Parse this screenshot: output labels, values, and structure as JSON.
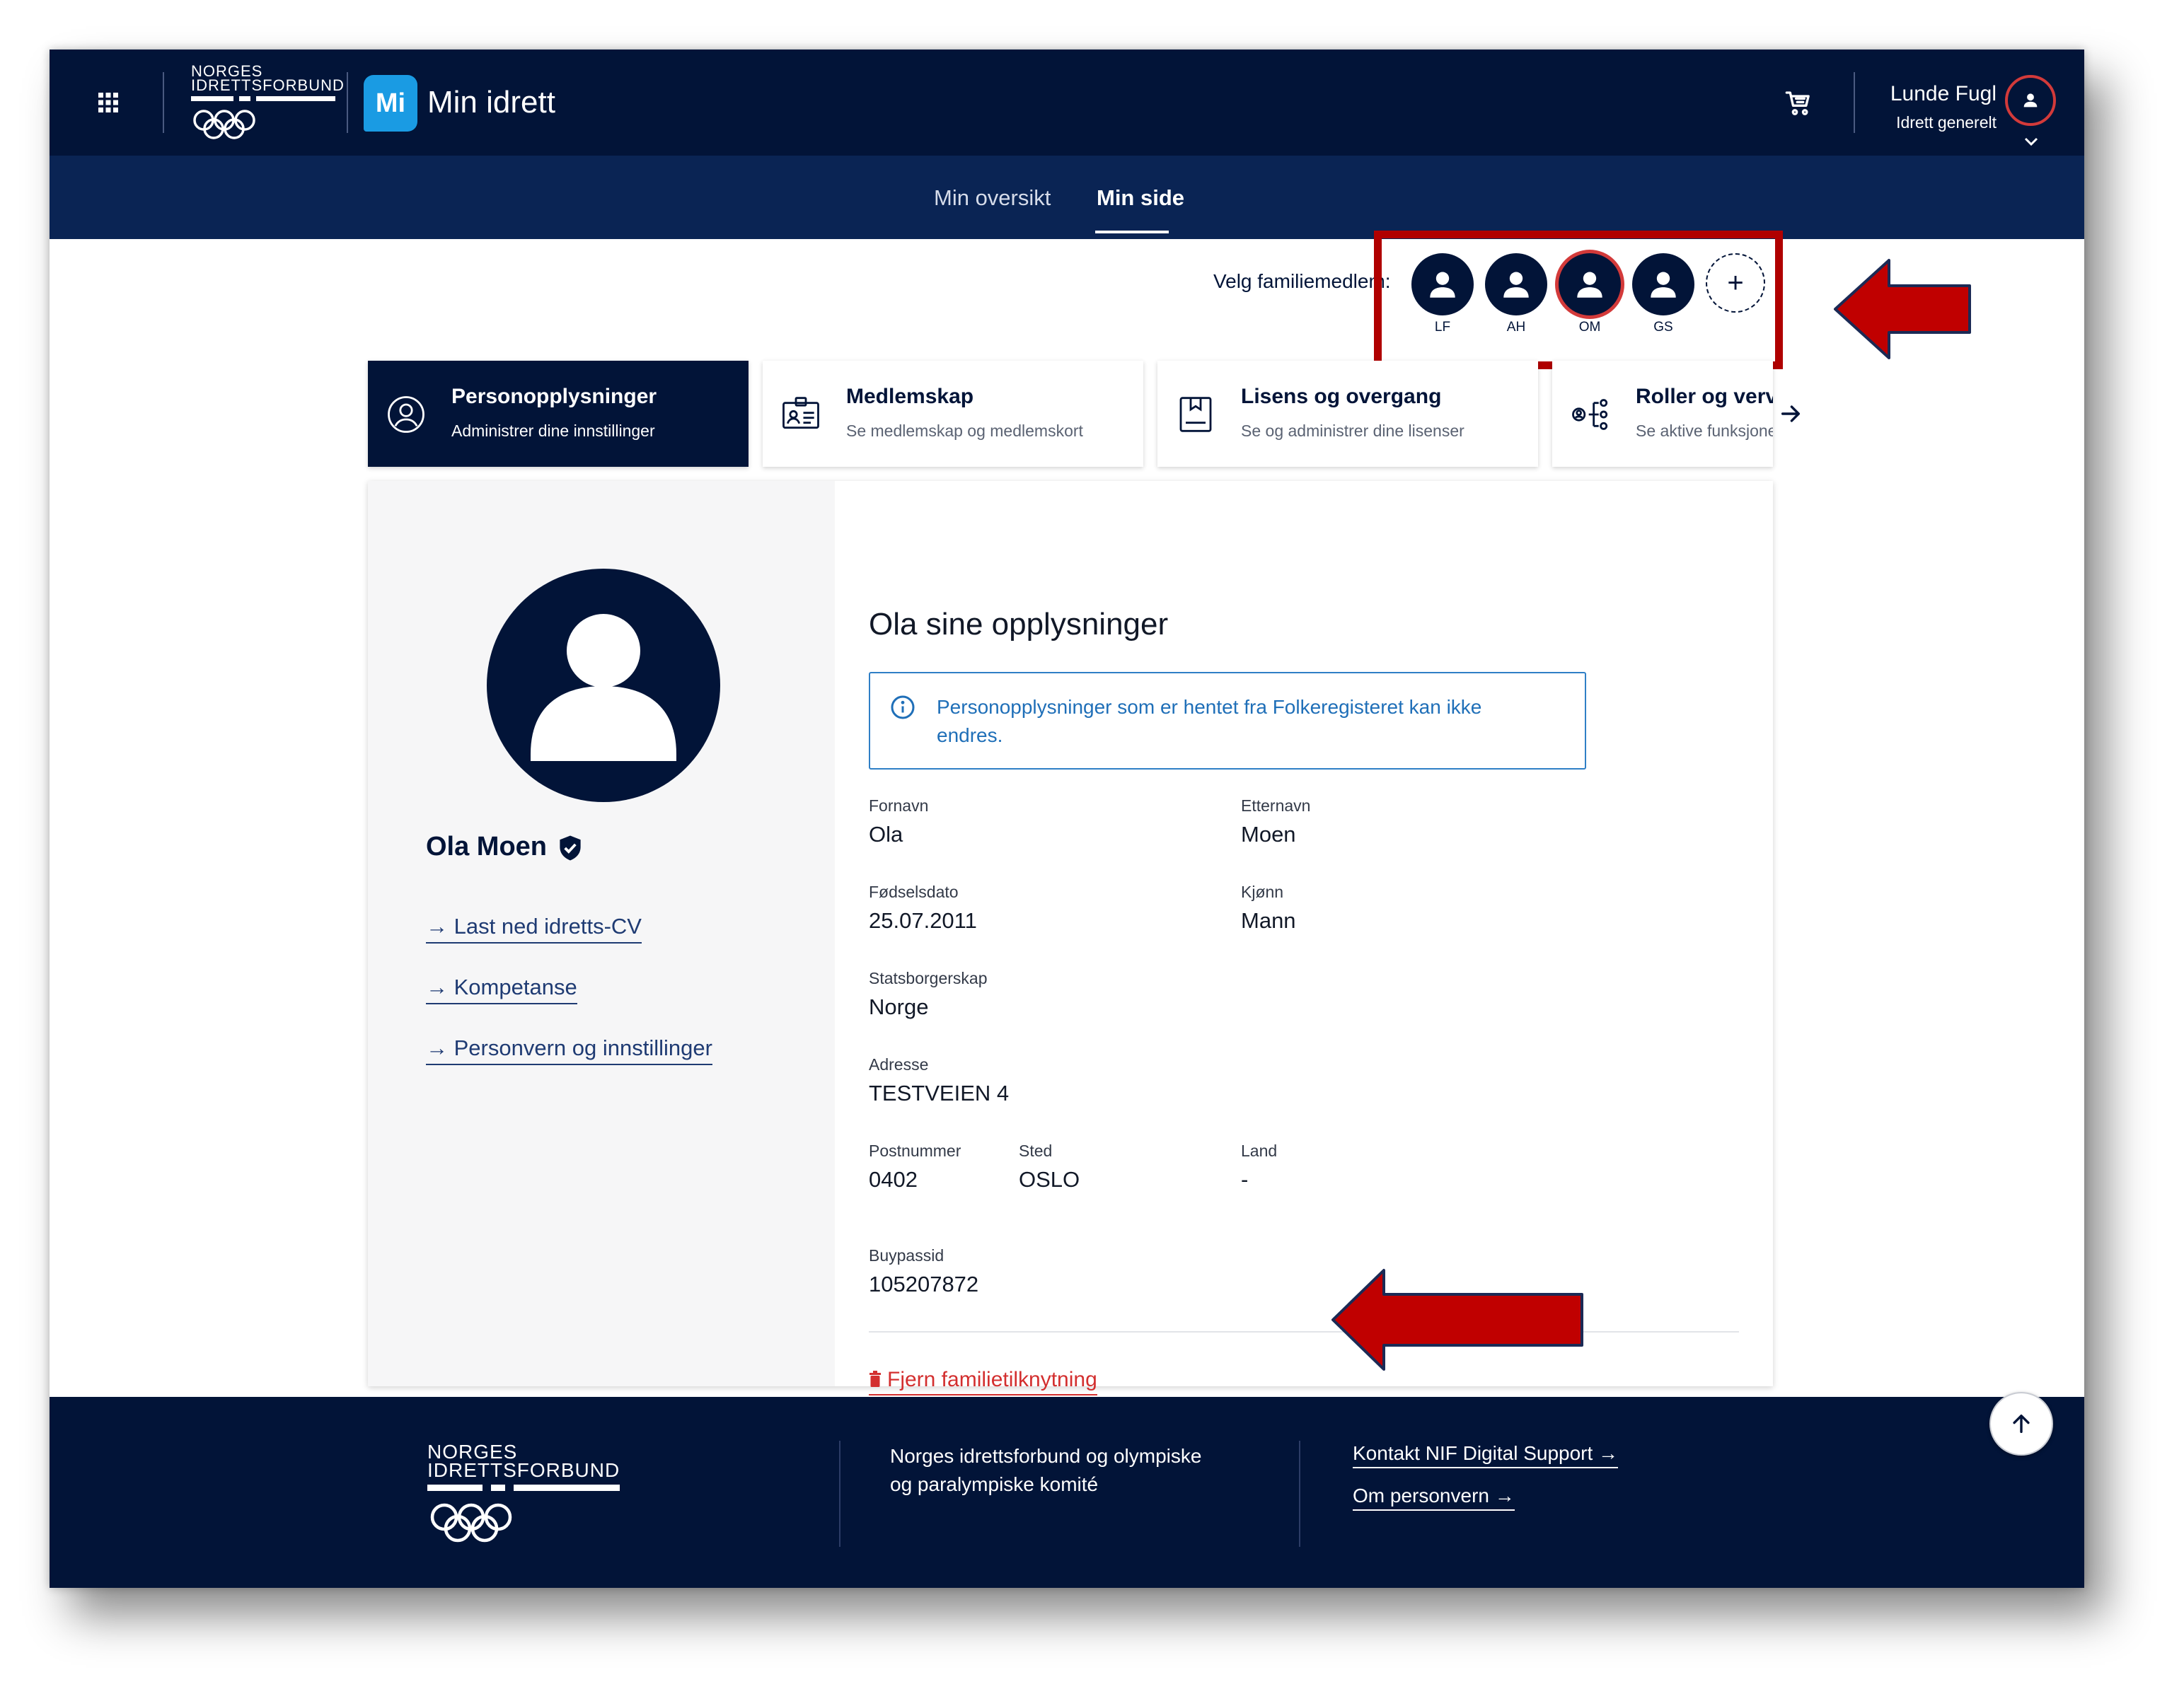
{
  "header": {
    "org_line1": "NORGES",
    "org_line2": "IDRETTSFORBUND",
    "app_badge": "Mi",
    "app_name": "Min idrett",
    "user_name": "Lunde Fugl",
    "user_role": "Idrett generelt"
  },
  "nav": {
    "tabs": [
      {
        "label": "Min oversikt",
        "active": false
      },
      {
        "label": "Min side",
        "active": true
      }
    ]
  },
  "family": {
    "label": "Velg familiemedlem:",
    "members": [
      {
        "initials": "LF",
        "selected": false
      },
      {
        "initials": "AH",
        "selected": false
      },
      {
        "initials": "OM",
        "selected": true
      },
      {
        "initials": "GS",
        "selected": false
      }
    ],
    "add_symbol": "+"
  },
  "cards": [
    {
      "title": "Personopplysninger",
      "subtitle": "Administrer dine innstillinger",
      "icon": "person-circle-icon",
      "active": true
    },
    {
      "title": "Medlemskap",
      "subtitle": "Se medlemskap og medlemskort",
      "icon": "id-card-icon",
      "active": false
    },
    {
      "title": "Lisens og overgang",
      "subtitle": "Se og administrer dine lisenser",
      "icon": "license-icon",
      "active": false
    },
    {
      "title": "Roller og verv",
      "subtitle": "Se aktive funksjoner",
      "icon": "roles-icon",
      "active": false
    }
  ],
  "profile": {
    "name": "Ola Moen",
    "links": [
      "Last ned idretts-CV",
      "Kompetanse",
      "Personvern og innstillinger"
    ]
  },
  "details": {
    "heading": "Ola sine opplysninger",
    "notice": "Personopplysninger som er hentet fra Folkeregisteret kan ikke endres.",
    "fields": {
      "fornavn": {
        "label": "Fornavn",
        "value": "Ola"
      },
      "etternavn": {
        "label": "Etternavn",
        "value": "Moen"
      },
      "fodselsdato": {
        "label": "Fødselsdato",
        "value": "25.07.2011"
      },
      "kjonn": {
        "label": "Kjønn",
        "value": "Mann"
      },
      "statsborgerskap": {
        "label": "Statsborgerskap",
        "value": "Norge"
      },
      "adresse": {
        "label": "Adresse",
        "value": "TESTVEIEN 4"
      },
      "postnummer": {
        "label": "Postnummer",
        "value": "0402"
      },
      "sted": {
        "label": "Sted",
        "value": "OSLO"
      },
      "land": {
        "label": "Land",
        "value": "-"
      },
      "buypassid": {
        "label": "Buypassid",
        "value": "105207872"
      }
    },
    "remove_link": "Fjern familietilknytning"
  },
  "footer": {
    "org_line1": "NORGES",
    "org_line2": "IDRETTSFORBUND",
    "description": "Norges idrettsforbund og olympiske og paralympiske komité",
    "links": [
      "Kontakt NIF Digital Support →",
      "Om personvern →"
    ]
  },
  "colors": {
    "navy": "#021438",
    "subnav": "#0a2454",
    "annotation_red": "#b00000",
    "link_blue": "#1f6fb8",
    "danger": "#d32f2f"
  }
}
